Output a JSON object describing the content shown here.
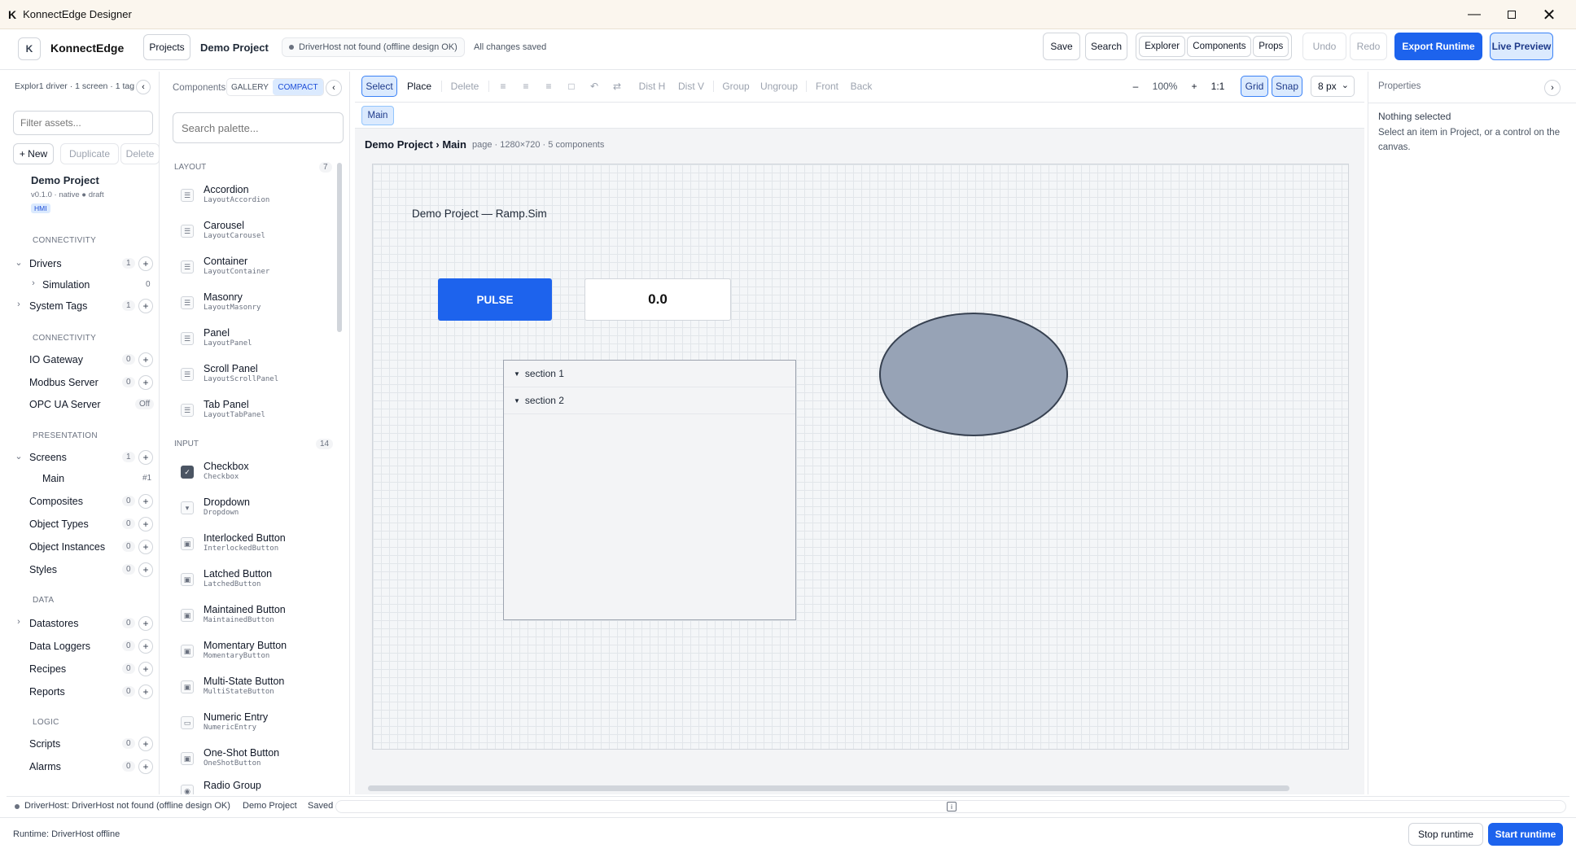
{
  "window": {
    "title": "KonnectEdge Designer",
    "controls": [
      "minimize-icon",
      "maximize-icon",
      "close-icon"
    ]
  },
  "header": {
    "brand": "KonnectEdge",
    "projects_button": "Projects",
    "project_name": "Demo Project",
    "driver_status": "DriverHost not found (offline design OK)",
    "save_status": "All changes saved",
    "save_button": "Save",
    "search_button": "Search",
    "view_toggles": [
      "Explorer",
      "Components",
      "Props"
    ],
    "undo": "Undo",
    "redo": "Redo",
    "export_button": "Export Runtime",
    "live_preview_button": "Live Preview"
  },
  "explorer": {
    "summary": "Explor1 driver · 1 screen · 1 tag",
    "filter_placeholder": "Filter assets...",
    "new_button": "+ New",
    "duplicate_button": "Duplicate",
    "delete_button": "Delete",
    "project": {
      "name": "Demo Project",
      "meta": "v0.1.0 · native ● draft",
      "badge": "HMI"
    },
    "sections": [
      {
        "title": "CONNECTIVITY",
        "items": [
          {
            "label": "Drivers",
            "count": "1",
            "expanded": true
          },
          {
            "label": "Simulation",
            "count": "0",
            "child": true
          },
          {
            "label": "System Tags",
            "count": "1",
            "expanded": false
          }
        ]
      },
      {
        "title": "CONNECTIVITY",
        "items": [
          {
            "label": "IO Gateway",
            "count": "0"
          },
          {
            "label": "Modbus Server",
            "count": "0"
          },
          {
            "label": "OPC UA Server",
            "count": "Off"
          }
        ]
      },
      {
        "title": "PRESENTATION",
        "items": [
          {
            "label": "Screens",
            "count": "1",
            "expanded": true
          },
          {
            "label": "Main",
            "count": "#1",
            "child": true
          },
          {
            "label": "Composites",
            "count": "0"
          },
          {
            "label": "Object Types",
            "count": "0"
          },
          {
            "label": "Object Instances",
            "count": "0"
          },
          {
            "label": "Styles",
            "count": "0"
          }
        ]
      },
      {
        "title": "DATA",
        "items": [
          {
            "label": "Datastores",
            "count": "0",
            "expanded": false
          },
          {
            "label": "Data Loggers",
            "count": "0"
          },
          {
            "label": "Recipes",
            "count": "0"
          },
          {
            "label": "Reports",
            "count": "0"
          }
        ]
      },
      {
        "title": "LOGIC",
        "items": [
          {
            "label": "Scripts",
            "count": "0"
          },
          {
            "label": "Alarms",
            "count": "0"
          }
        ]
      }
    ]
  },
  "palette": {
    "title": "Components",
    "tabs": [
      "GALLERY",
      "COMPACT"
    ],
    "search_placeholder": "Search palette...",
    "groups": [
      {
        "title": "LAYOUT",
        "count": "7",
        "items": [
          {
            "name": "Accordion",
            "type": "LayoutAccordion"
          },
          {
            "name": "Carousel",
            "type": "LayoutCarousel"
          },
          {
            "name": "Container",
            "type": "LayoutContainer"
          },
          {
            "name": "Masonry",
            "type": "LayoutMasonry"
          },
          {
            "name": "Panel",
            "type": "LayoutPanel"
          },
          {
            "name": "Scroll Panel",
            "type": "LayoutScrollPanel"
          },
          {
            "name": "Tab Panel",
            "type": "LayoutTabPanel"
          }
        ]
      },
      {
        "title": "INPUT",
        "count": "14",
        "items": [
          {
            "name": "Checkbox",
            "type": "Checkbox"
          },
          {
            "name": "Dropdown",
            "type": "Dropdown"
          },
          {
            "name": "Interlocked Button",
            "type": "InterlockedButton"
          },
          {
            "name": "Latched Button",
            "type": "LatchedButton"
          },
          {
            "name": "Maintained Button",
            "type": "MaintainedButton"
          },
          {
            "name": "Momentary Button",
            "type": "MomentaryButton"
          },
          {
            "name": "Multi-State Button",
            "type": "MultiStateButton"
          },
          {
            "name": "Numeric Entry",
            "type": "NumericEntry"
          },
          {
            "name": "One-Shot Button",
            "type": "OneShotButton"
          },
          {
            "name": "Radio Group",
            "type": ""
          }
        ]
      }
    ]
  },
  "toolbar": {
    "select": "Select",
    "place": "Place",
    "delete": "Delete",
    "dist_h": "Dist H",
    "dist_v": "Dist V",
    "group": "Group",
    "ungroup": "Ungroup",
    "front": "Front",
    "back": "Back",
    "zoom_out": "–",
    "zoom": "100%",
    "zoom_in": "+",
    "one_to_one": "1:1",
    "grid": "Grid",
    "snap": "Snap",
    "grid_size": "8 px"
  },
  "screen_tab": "Main",
  "canvas": {
    "breadcrumb": "Demo Project › Main",
    "page_info": "page · 1280×720 · 5 components",
    "label": "Demo Project — Ramp.Sim",
    "pulse_button": "PULSE",
    "numeric_value": "0.0",
    "accordion_sections": [
      "section 1",
      "section 2"
    ],
    "ellipse_fill": "#97a3b6"
  },
  "properties": {
    "title": "Properties",
    "empty_title": "Nothing selected",
    "empty_hint": "Select an item in Project, or a control on the canvas."
  },
  "statusbar": {
    "driver": "DriverHost: DriverHost not found (offline design OK)",
    "project": "Demo Project",
    "saved": "Saved",
    "runtime": "Runtime: DriverHost offline",
    "stop_button": "Stop runtime",
    "start_button": "Start runtime"
  },
  "colors": {
    "accent": "#1d63ed",
    "active_toggle_bg": "#dbeafe"
  }
}
